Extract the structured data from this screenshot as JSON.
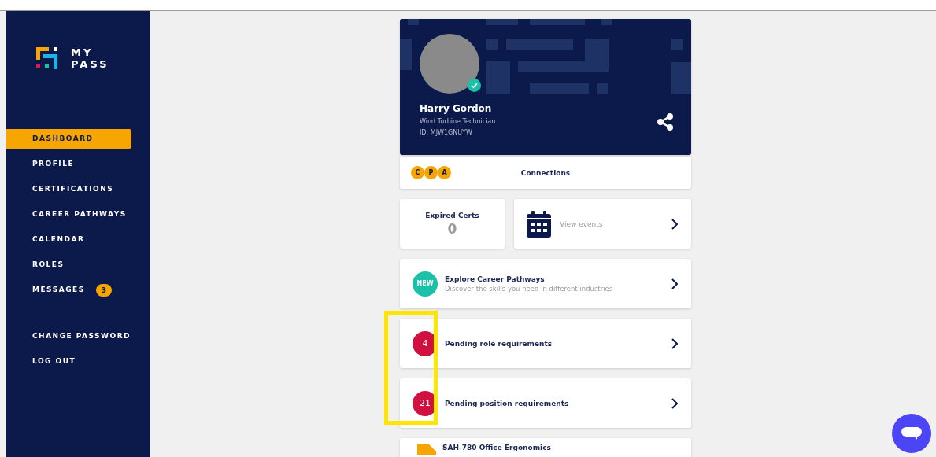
{
  "logo": {
    "line_1": "MY",
    "line_2": "PASS"
  },
  "sidebar": {
    "items": [
      {
        "label": "DASHBOARD",
        "selected": true
      },
      {
        "label": "PROFILE",
        "selected": false
      },
      {
        "label": "CERTIFICATIONS",
        "selected": false
      },
      {
        "label": "CAREER PATHWAYS",
        "selected": false
      },
      {
        "label": "CALENDAR",
        "selected": false
      },
      {
        "label": "ROLES",
        "selected": false
      },
      {
        "label": "MESSAGES",
        "selected": false,
        "badge": "3"
      }
    ],
    "account_items": [
      {
        "label": "CHANGE PASSWORD"
      },
      {
        "label": "LOG OUT"
      }
    ]
  },
  "profile": {
    "name": "Harry Gordon",
    "job_title": "Wind Turbine Technician",
    "id": "ID: MJW1GNUYW",
    "verified": true
  },
  "connections": {
    "initials": [
      "C",
      "P",
      "A"
    ],
    "label": "Connections"
  },
  "expired_certs": {
    "label": "Expired Certs",
    "count": "0"
  },
  "events": {
    "label": "View events"
  },
  "explore": {
    "badge": "NEW",
    "title": "Explore Career Pathways",
    "subtitle": "Discover the skills you need in different industries"
  },
  "pending": [
    {
      "count": "4",
      "label": "Pending role requirements"
    },
    {
      "count": "21",
      "label": "Pending position requirements"
    }
  ],
  "course": {
    "title": "SAH-780 Office Ergonomics"
  }
}
